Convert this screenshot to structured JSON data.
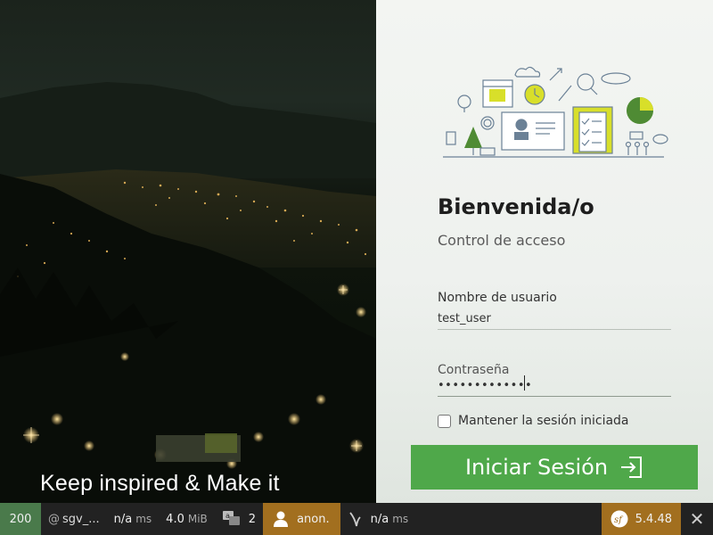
{
  "hero": {
    "caption": "Keep inspired & Make it"
  },
  "login": {
    "title": "Bienvenida/o",
    "subtitle": "Control de acceso",
    "username_label": "Nombre de usuario",
    "username_value": "test_user",
    "password_label": "Contraseña",
    "password_value": "•••••••••••••",
    "remember_label": "Mantener la sesión iniciada",
    "remember_checked": false,
    "submit_label": "Iniciar Sesión",
    "accent_color": "#4fa84a"
  },
  "toolbar": {
    "status_code": "200",
    "route_prefix": "@",
    "route": "sgv_...",
    "time_value": "n/a",
    "time_unit": "ms",
    "memory_value": "4.0",
    "memory_unit": "MiB",
    "translations_count": "2",
    "user": "anon.",
    "twig_time": "n/a",
    "twig_unit": "ms",
    "symfony_version": "5.4.48",
    "close_symbol": "✕",
    "status_color": "#4a7a4b",
    "user_color": "#a26f1f"
  }
}
